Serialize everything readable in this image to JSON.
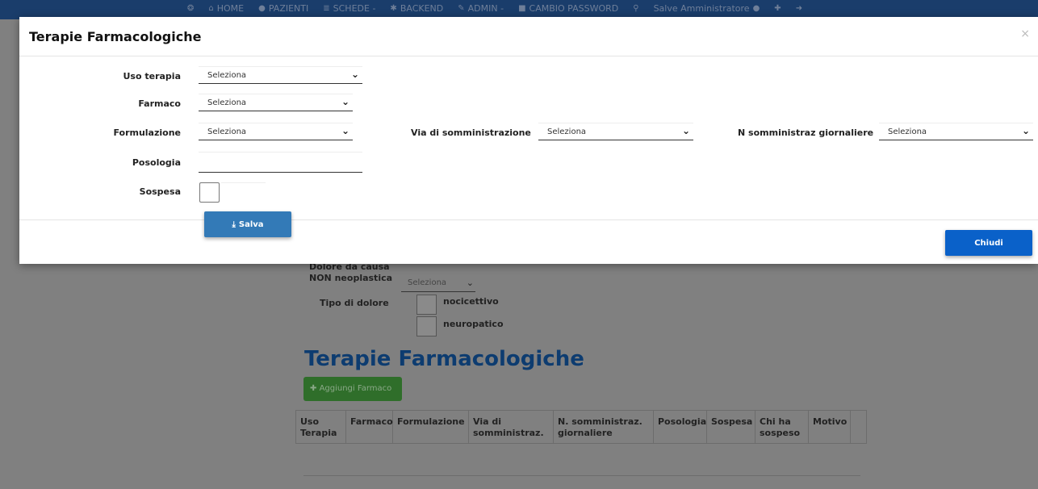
{
  "navbar": {
    "items": [
      {
        "label": "",
        "icon": "logo-icon"
      },
      {
        "label": "HOME",
        "icon": "home-icon"
      },
      {
        "label": "PAZIENTI",
        "icon": "user-icon"
      },
      {
        "label": "SCHEDE -",
        "icon": "list-icon"
      },
      {
        "label": "BACKEND",
        "icon": "asterisk-icon"
      },
      {
        "label": "ADMIN -",
        "icon": "wrench-icon"
      },
      {
        "label": "CAMBIO PASSWORD",
        "icon": "lock-icon"
      },
      {
        "label": "",
        "icon": "search-icon"
      },
      {
        "label": "Salve Amministratore",
        "icon": "user-icon"
      },
      {
        "label": "",
        "icon": "plus-icon"
      },
      {
        "label": "",
        "icon": "logout-icon"
      }
    ]
  },
  "background": {
    "dolore_label": "Dolore da causa NON neoplastica",
    "dolore_value": "Seleziona",
    "tipo_dolore_label": "Tipo di dolore",
    "nocicettivo_label": "nocicettivo",
    "neuropatico_label": "neuropatico",
    "section_title": "Terapie Farmacologiche",
    "add_button": "Aggiungi Farmaco",
    "table_headers": [
      "Uso Terapia",
      "Farmaco",
      "Formulazione",
      "Via di somministraz.",
      "N. somministraz. giornaliere",
      "Posologia",
      "Sospesa",
      "Chi ha sospeso",
      "Motivo"
    ]
  },
  "modal": {
    "title": "Terapie Farmacologiche",
    "close_symbol": "×",
    "fields": {
      "uso_terapia": {
        "label": "Uso terapia",
        "value": "Seleziona"
      },
      "farmaco": {
        "label": "Farmaco",
        "value": "Seleziona"
      },
      "formulazione": {
        "label": "Formulazione",
        "value": "Seleziona"
      },
      "via_somministrazione": {
        "label": "Via di somministrazione",
        "value": "Seleziona"
      },
      "n_somministraz": {
        "label": "N somministraz giornaliere",
        "value": "Seleziona"
      },
      "posologia": {
        "label": "Posologia",
        "value": ""
      },
      "sospesa": {
        "label": "Sospesa",
        "checked": false
      }
    },
    "save_button": "Salva",
    "close_button": "Chiudi"
  },
  "colors": {
    "primary": "#337ab7",
    "close_btn": "#0a61c9",
    "navbar": "#1a3d6b",
    "title_blue": "#0d3c70",
    "add_green": "#2f6e2a"
  }
}
